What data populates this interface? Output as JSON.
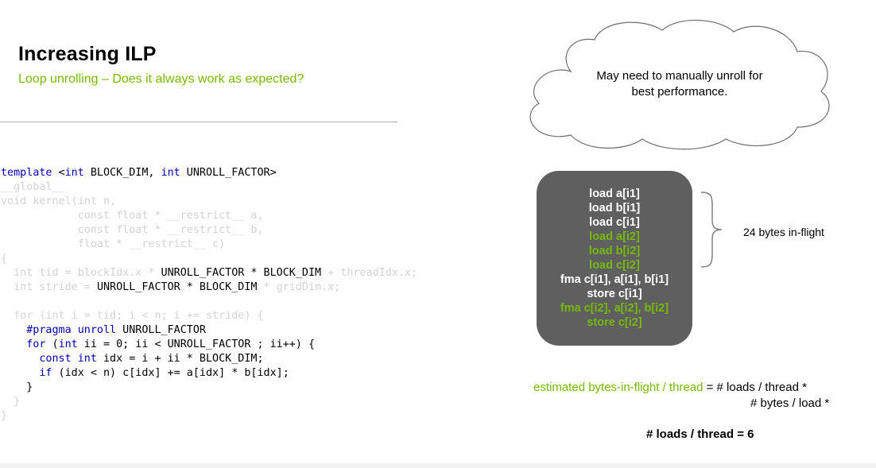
{
  "slide": {
    "title": "Increasing ILP",
    "subtitle": "Loop unrolling – Does it always work as expected?"
  },
  "code": {
    "l1_kw1": "template",
    "l1_t1": " <",
    "l1_kw2": "int",
    "l1_t2": " BLOCK_DIM, ",
    "l1_kw3": "int",
    "l1_t3": " UNROLL_FACTOR>",
    "l2": "__global__",
    "l3": "void kernel(int n,",
    "l4": "            const float * __restrict__ a,",
    "l5": "            const float * __restrict__ b,",
    "l6": "            float * __restrict__ c)",
    "l7": "{",
    "l8_d1": "  int tid = blockIdx.x * ",
    "l8_t": "UNROLL_FACTOR * BLOCK_DIM",
    "l8_d2": " + threadIdx.x;",
    "l9_d1": "  int stride = ",
    "l9_t": "UNROLL_FACTOR * BLOCK_DIM",
    "l9_d2": " * gridDim.x;",
    "l11": "  for (int i = tid; i < n; i += stride) {",
    "l12_kw": "    #pragma unroll",
    "l12_t": " UNROLL_FACTOR",
    "l13_kw1": "    for",
    "l13_t1": " (",
    "l13_kw2": "int",
    "l13_t2": " ii = 0; ii < UNROLL_FACTOR ; ii++) {",
    "l14_kw1": "      const int",
    "l14_t": " idx = i + ii * BLOCK_DIM;",
    "l15_kw": "      if",
    "l15_t": " (idx < n) c[idx] += a[idx] * b[idx];",
    "l16": "    }",
    "l17": "  }",
    "l18": "}"
  },
  "cloud": {
    "line1": "May need to manually unroll for",
    "line2": "best performance."
  },
  "instructions": [
    {
      "text": "load a[i1]",
      "color": "#ffffff"
    },
    {
      "text": "load b[i1]",
      "color": "#ffffff"
    },
    {
      "text": "load c[i1]",
      "color": "#ffffff"
    },
    {
      "text": "load a[i2]",
      "color": "#76b900"
    },
    {
      "text": "load b[i2]",
      "color": "#76b900"
    },
    {
      "text": "load c[i2]",
      "color": "#76b900"
    },
    {
      "text": "fma c[i1], a[i1], b[i1]",
      "color": "#ffffff"
    },
    {
      "text": "store c[i1]",
      "color": "#ffffff"
    },
    {
      "text": "fma c[i2], a[i2], b[i2]",
      "color": "#76b900"
    },
    {
      "text": "store c[i2]",
      "color": "#76b900"
    }
  ],
  "inflight_label": "24 bytes in-flight",
  "formula": {
    "green_part": "estimated bytes-in-flight / thread",
    "rest_part": " = # loads / thread *",
    "line2": "# bytes / load *",
    "loads": "# loads / thread = 6"
  },
  "colors": {
    "accent": "#76b900",
    "box": "#5f5f5f",
    "keyword": "#0000b4",
    "dimmed": "#d3d3d3"
  }
}
